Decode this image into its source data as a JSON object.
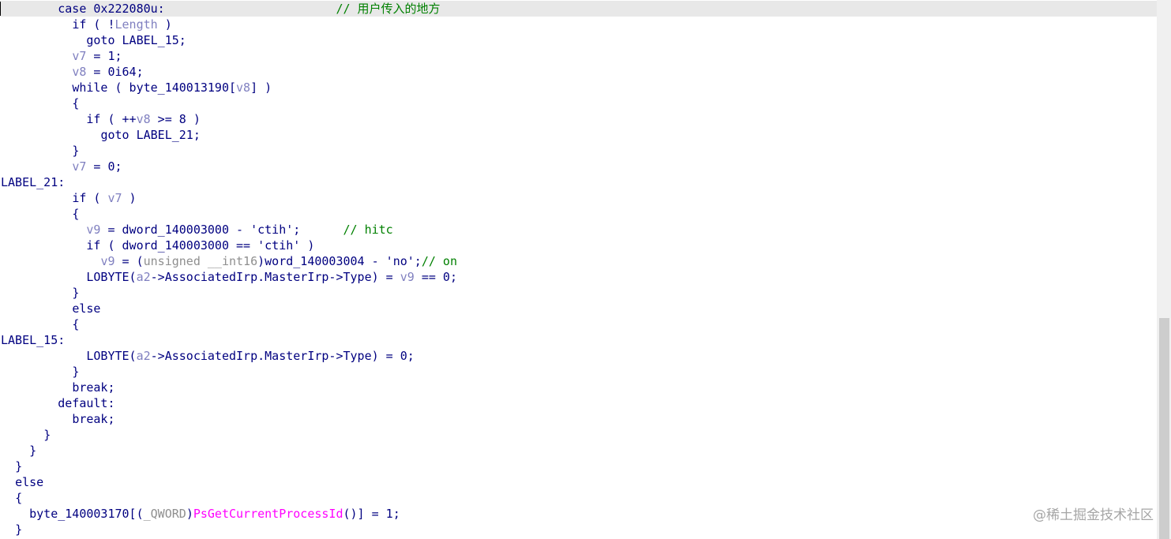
{
  "code_lines": [
    {
      "indent": 8,
      "current": true,
      "tokens": [
        {
          "t": "case 0x222080u:",
          "c": "code"
        },
        {
          "t": "                        ",
          "c": "code"
        },
        {
          "t": "// 用户传入的地方",
          "c": "cmt"
        }
      ]
    },
    {
      "indent": 10,
      "tokens": [
        {
          "t": "if ( !",
          "c": "code"
        },
        {
          "t": "Length",
          "c": "var"
        },
        {
          "t": " )",
          "c": "code"
        }
      ]
    },
    {
      "indent": 12,
      "tokens": [
        {
          "t": "goto LABEL_15;",
          "c": "code"
        }
      ]
    },
    {
      "indent": 10,
      "tokens": [
        {
          "t": "v7",
          "c": "var"
        },
        {
          "t": " = 1;",
          "c": "code"
        }
      ]
    },
    {
      "indent": 10,
      "tokens": [
        {
          "t": "v8",
          "c": "var"
        },
        {
          "t": " = 0i64;",
          "c": "code"
        }
      ]
    },
    {
      "indent": 10,
      "tokens": [
        {
          "t": "while ( byte_140013190[",
          "c": "code"
        },
        {
          "t": "v8",
          "c": "var"
        },
        {
          "t": "] )",
          "c": "code"
        }
      ]
    },
    {
      "indent": 10,
      "tokens": [
        {
          "t": "{",
          "c": "code"
        }
      ]
    },
    {
      "indent": 12,
      "tokens": [
        {
          "t": "if ( ++",
          "c": "code"
        },
        {
          "t": "v8",
          "c": "var"
        },
        {
          "t": " >= 8 )",
          "c": "code"
        }
      ]
    },
    {
      "indent": 14,
      "tokens": [
        {
          "t": "goto LABEL_21;",
          "c": "code"
        }
      ]
    },
    {
      "indent": 10,
      "tokens": [
        {
          "t": "}",
          "c": "code"
        }
      ]
    },
    {
      "indent": 10,
      "tokens": [
        {
          "t": "v7",
          "c": "var"
        },
        {
          "t": " = 0;",
          "c": "code"
        }
      ]
    },
    {
      "indent": 0,
      "tokens": [
        {
          "t": "LABEL_21:",
          "c": "code"
        }
      ]
    },
    {
      "indent": 10,
      "tokens": [
        {
          "t": "if ( ",
          "c": "code"
        },
        {
          "t": "v7",
          "c": "var"
        },
        {
          "t": " )",
          "c": "code"
        }
      ]
    },
    {
      "indent": 10,
      "tokens": [
        {
          "t": "{",
          "c": "code"
        }
      ]
    },
    {
      "indent": 12,
      "tokens": [
        {
          "t": "v9",
          "c": "var"
        },
        {
          "t": " = dword_140003000 - 'ctih';",
          "c": "code"
        },
        {
          "t": "      ",
          "c": "code"
        },
        {
          "t": "// hitc",
          "c": "cmt"
        }
      ]
    },
    {
      "indent": 12,
      "tokens": [
        {
          "t": "if ( dword_140003000 == 'ctih' )",
          "c": "code"
        }
      ]
    },
    {
      "indent": 14,
      "tokens": [
        {
          "t": "v9",
          "c": "var"
        },
        {
          "t": " = (",
          "c": "code"
        },
        {
          "t": "unsigned __int16",
          "c": "type"
        },
        {
          "t": ")word_140003004 - 'no';",
          "c": "code"
        },
        {
          "t": "// on",
          "c": "cmt"
        }
      ]
    },
    {
      "indent": 12,
      "tokens": [
        {
          "t": "LOBYTE(",
          "c": "code"
        },
        {
          "t": "a2",
          "c": "var"
        },
        {
          "t": "->AssociatedIrp.MasterIrp->Type) = ",
          "c": "code"
        },
        {
          "t": "v9",
          "c": "var"
        },
        {
          "t": " == 0;",
          "c": "code"
        }
      ]
    },
    {
      "indent": 10,
      "tokens": [
        {
          "t": "}",
          "c": "code"
        }
      ]
    },
    {
      "indent": 10,
      "tokens": [
        {
          "t": "else",
          "c": "code"
        }
      ]
    },
    {
      "indent": 10,
      "tokens": [
        {
          "t": "{",
          "c": "code"
        }
      ]
    },
    {
      "indent": 0,
      "tokens": [
        {
          "t": "LABEL_15:",
          "c": "code"
        }
      ]
    },
    {
      "indent": 12,
      "tokens": [
        {
          "t": "LOBYTE(",
          "c": "code"
        },
        {
          "t": "a2",
          "c": "var"
        },
        {
          "t": "->AssociatedIrp.MasterIrp->Type) = 0;",
          "c": "code"
        }
      ]
    },
    {
      "indent": 10,
      "tokens": [
        {
          "t": "}",
          "c": "code"
        }
      ]
    },
    {
      "indent": 10,
      "tokens": [
        {
          "t": "break;",
          "c": "code"
        }
      ]
    },
    {
      "indent": 8,
      "tokens": [
        {
          "t": "default:",
          "c": "code"
        }
      ]
    },
    {
      "indent": 10,
      "tokens": [
        {
          "t": "break;",
          "c": "code"
        }
      ]
    },
    {
      "indent": 6,
      "tokens": [
        {
          "t": "}",
          "c": "code"
        }
      ]
    },
    {
      "indent": 4,
      "tokens": [
        {
          "t": "}",
          "c": "code"
        }
      ]
    },
    {
      "indent": 2,
      "tokens": [
        {
          "t": "}",
          "c": "code"
        }
      ]
    },
    {
      "indent": 2,
      "tokens": [
        {
          "t": "else",
          "c": "code"
        }
      ]
    },
    {
      "indent": 2,
      "tokens": [
        {
          "t": "{",
          "c": "code"
        }
      ]
    },
    {
      "indent": 4,
      "tokens": [
        {
          "t": "byte_140003170[(",
          "c": "code"
        },
        {
          "t": "_QWORD",
          "c": "type"
        },
        {
          "t": ")",
          "c": "code"
        },
        {
          "t": "PsGetCurrentProcessId",
          "c": "func"
        },
        {
          "t": "()] = 1;",
          "c": "code"
        }
      ]
    },
    {
      "indent": 2,
      "tokens": [
        {
          "t": "}",
          "c": "code"
        }
      ]
    }
  ],
  "scrollbar": {
    "position": 0.59,
    "visible_fraction": 0.41
  },
  "watermark": "@稀土掘金技术社区",
  "colors": {
    "code": "#000080",
    "variable": "#8080c0",
    "comment": "#008000",
    "type": "#8f8f8f",
    "function": "#ff00ff",
    "current_line": "#e8e8e8"
  }
}
